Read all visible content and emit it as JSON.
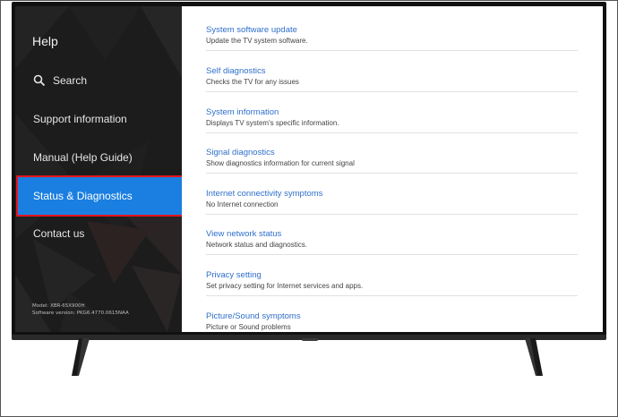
{
  "sidebar": {
    "title": "Help",
    "items": [
      {
        "label": "Search",
        "icon": "search-icon"
      },
      {
        "label": "Support information"
      },
      {
        "label": "Manual (Help Guide)"
      },
      {
        "label": "Status & Diagnostics",
        "selected": true,
        "highlight_color": "#e3151b"
      },
      {
        "label": "Contact us"
      }
    ],
    "model": "Model: XBR-65X900H",
    "software_version": "Software version: PKG6.4770.0615NAA"
  },
  "main": {
    "items": [
      {
        "title": "System software update",
        "desc": "Update the TV system software."
      },
      {
        "title": "Self diagnostics",
        "desc": "Checks the TV for any issues"
      },
      {
        "title": "System information",
        "desc": "Displays TV system's specific information."
      },
      {
        "title": "Signal diagnostics",
        "desc": "Show diagnostics information for current signal"
      },
      {
        "title": "Internet connectivity symptoms",
        "desc": "No Internet connection"
      },
      {
        "title": "View network status",
        "desc": "Network status and diagnostics."
      },
      {
        "title": "Privacy setting",
        "desc": "Set privacy setting for Internet services and apps."
      },
      {
        "title": "Picture/Sound symptoms",
        "desc": "Picture or Sound problems"
      }
    ]
  },
  "colors": {
    "accent": "#1a7fe0",
    "link": "#2f6fcb",
    "sidebar_bg": "#1d1d1d"
  }
}
